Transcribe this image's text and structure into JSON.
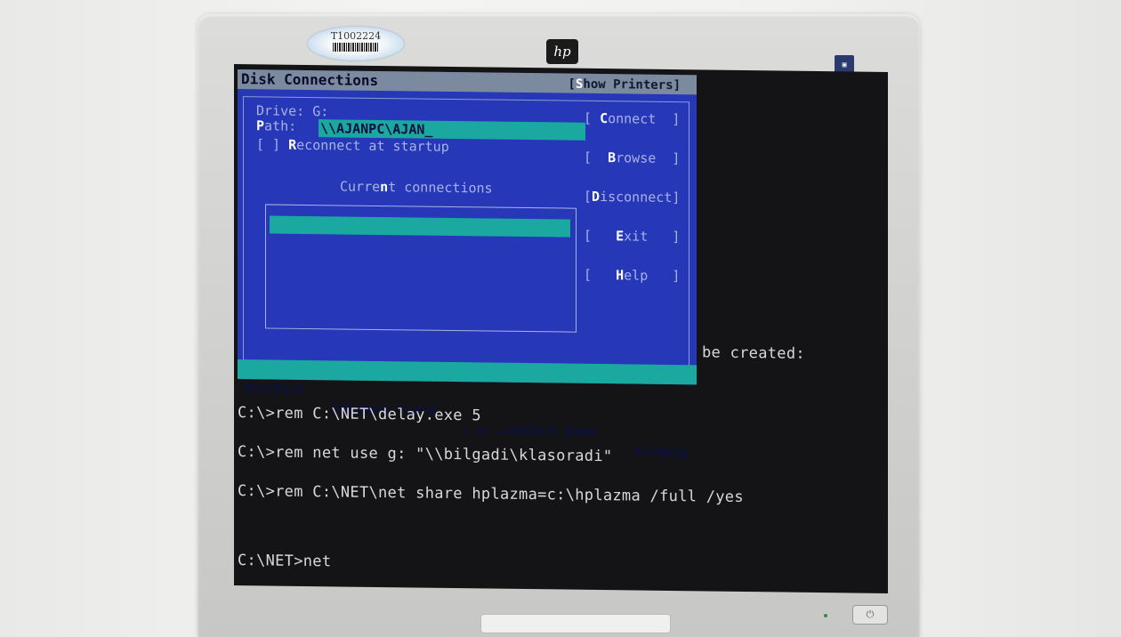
{
  "monitor": {
    "asset_tag": "T1002224",
    "brand_logo_icon": "hp-logo",
    "power_glyph": "⏻"
  },
  "dialog": {
    "title": "Disk Connections",
    "show_printers": {
      "open": "[",
      "hot": "S",
      "rest": "how Printers]"
    },
    "drive_label": "Drive: G:",
    "path_label": {
      "hot": "P",
      "rest": "ath:"
    },
    "path_value": "\\\\AJANPC\\AJAN_",
    "reconnect": {
      "box": "[ ] ",
      "hot": "R",
      "rest": "econnect at startup"
    },
    "current_connections": {
      "pre": "Curre",
      "hot": "n",
      "post": "t connections"
    },
    "buttons": {
      "connect": {
        "pre": "[ ",
        "hot": "C",
        "post": "onnect  ]"
      },
      "browse": {
        "pre": "[  ",
        "hot": "B",
        "post": "rowse  ]"
      },
      "disconnect": {
        "pre": "[",
        "hot": "D",
        "post": "isconnect]"
      },
      "exit": {
        "pre": "[   ",
        "hot": "E",
        "post": "xit   ]"
      },
      "help": {
        "pre": "[   ",
        "hot": "H",
        "post": "elp   ]"
      }
    },
    "status": {
      "esc": "ESC=Exit",
      "tab": "TAB=Next Field",
      "arrows": "↑ or ↓=Select Item",
      "f1": "F1=Help"
    }
  },
  "console": {
    "partial_line": "be created:",
    "lines": [
      "C:\\>rem C:\\NET\\delay.exe 5",
      "C:\\>rem net use g: \"\\\\bilgadi\\klasoradi\"",
      "C:\\>rem C:\\NET\\net share hplazma=c:\\hplazma /full /yes",
      "C:\\NET>net"
    ]
  }
}
